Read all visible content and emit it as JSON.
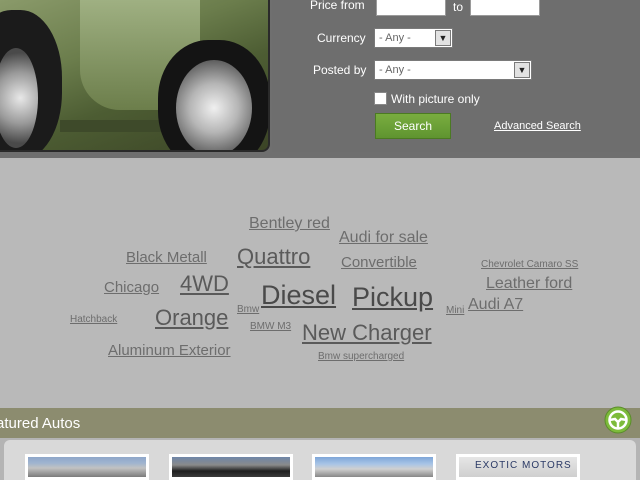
{
  "search": {
    "price_from_label": "Price from",
    "price_to_label": "to",
    "price_from_value": "",
    "price_to_value": "",
    "currency_label": "Currency",
    "currency_value": "- Any -",
    "posted_by_label": "Posted by",
    "posted_by_value": "- Any -",
    "with_picture_label": "With picture only",
    "search_button": "Search",
    "advanced_link": "Advanced Search"
  },
  "tag_cloud": [
    {
      "text": "Bentley red"
    },
    {
      "text": "Audi for sale"
    },
    {
      "text": "Black Metall"
    },
    {
      "text": "Quattro"
    },
    {
      "text": "Convertible"
    },
    {
      "text": "Chevrolet Camaro SS"
    },
    {
      "text": "Chicago"
    },
    {
      "text": "4WD"
    },
    {
      "text": "Leather ford"
    },
    {
      "text": "Diesel"
    },
    {
      "text": "Pickup"
    },
    {
      "text": "Bmw"
    },
    {
      "text": "Mini"
    },
    {
      "text": "Audi A7"
    },
    {
      "text": "Hatchback"
    },
    {
      "text": "Orange"
    },
    {
      "text": "BMW M3"
    },
    {
      "text": "New Charger"
    },
    {
      "text": "Aluminum Exterior"
    },
    {
      "text": "Bmw supercharged"
    }
  ],
  "featured": {
    "title": "atured Autos",
    "icon": "steering-wheel-icon",
    "thumbs": [
      {
        "icon": "car-photo-thumb"
      },
      {
        "icon": "car-photo-thumb"
      },
      {
        "icon": "car-photo-thumb"
      },
      {
        "icon": "dealer-photo-thumb",
        "caption": "EXOTIC MOTORS"
      }
    ]
  },
  "colors": {
    "accent_green": "#6b9f35",
    "panel_gray": "#6e6e6e",
    "tag_gray": "#6d6d6d",
    "featured_bar": "#8c8c6f"
  }
}
